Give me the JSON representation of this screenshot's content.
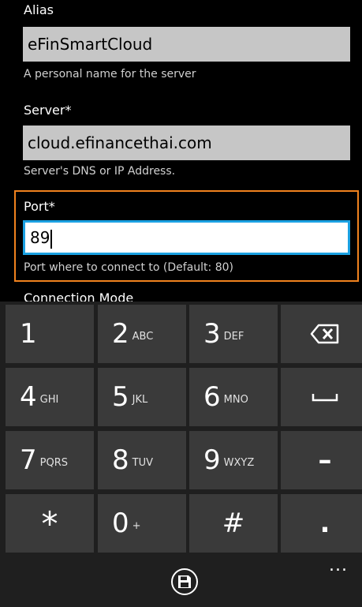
{
  "form": {
    "alias": {
      "label": "Alias",
      "value": "eFinSmartCloud",
      "hint": "A personal name for the server"
    },
    "server": {
      "label": "Server*",
      "value": "cloud.efinancethai.com",
      "hint": "Server's DNS or IP Address."
    },
    "port": {
      "label": "Port*",
      "value": "89",
      "hint": "Port where to connect to (Default: 80)"
    },
    "next_label_peek": "Connection Mode"
  },
  "keypad": {
    "keys": [
      {
        "digit": "1",
        "letters": ""
      },
      {
        "digit": "2",
        "letters": "ABC"
      },
      {
        "digit": "3",
        "letters": "DEF"
      },
      {
        "digit": "4",
        "letters": "GHI"
      },
      {
        "digit": "5",
        "letters": "JKL"
      },
      {
        "digit": "6",
        "letters": "MNO"
      },
      {
        "digit": "7",
        "letters": "PQRS"
      },
      {
        "digit": "8",
        "letters": "TUV"
      },
      {
        "digit": "9",
        "letters": "WXYZ"
      },
      {
        "digit": "0",
        "letters": "+"
      }
    ],
    "star": "*",
    "hash": "#",
    "dash": "–",
    "dot": "."
  },
  "appbar": {
    "more": "..."
  },
  "colors": {
    "focus": "#f0821e",
    "active_border": "#1ba1e2",
    "key_bg": "#3a3a3a"
  }
}
